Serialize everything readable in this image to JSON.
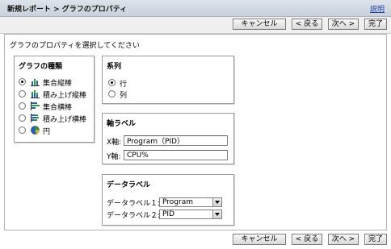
{
  "header": {
    "breadcrumb": "新規レポート > グラフのプロパティ",
    "help": "説明"
  },
  "buttons": {
    "cancel": "キャンセル",
    "back": "< 戻る",
    "next": "次へ >",
    "done": "完了"
  },
  "prompt": "グラフのプロパティを選択してください",
  "chart_type": {
    "title": "グラフの種類",
    "options": [
      {
        "label": "集合縦棒",
        "icon": "clustered-column-icon",
        "selected": true
      },
      {
        "label": "積み上げ縦棒",
        "icon": "stacked-column-icon",
        "selected": false
      },
      {
        "label": "集合横棒",
        "icon": "clustered-bar-icon",
        "selected": false
      },
      {
        "label": "積み上げ横棒",
        "icon": "stacked-bar-icon",
        "selected": false
      },
      {
        "label": "円",
        "icon": "pie-icon",
        "selected": false
      }
    ]
  },
  "series": {
    "title": "系列",
    "options": [
      {
        "label": "行",
        "selected": true
      },
      {
        "label": "列",
        "selected": false
      }
    ]
  },
  "axis_labels": {
    "title": "軸ラベル",
    "x_label": "X軸:",
    "x_value": "Program（PID）",
    "y_label": "Y軸:",
    "y_value": "CPU%"
  },
  "data_labels": {
    "title": "データラベル",
    "label1": "データラベル１:",
    "value1": "Program",
    "label2": "データラベル２:",
    "value2": "PID"
  },
  "colors": {
    "title_bar": "#d3d9e1",
    "help_link": "#1d3fa8",
    "icon_blue": "#1f5fc6",
    "icon_green": "#2e9b34"
  }
}
